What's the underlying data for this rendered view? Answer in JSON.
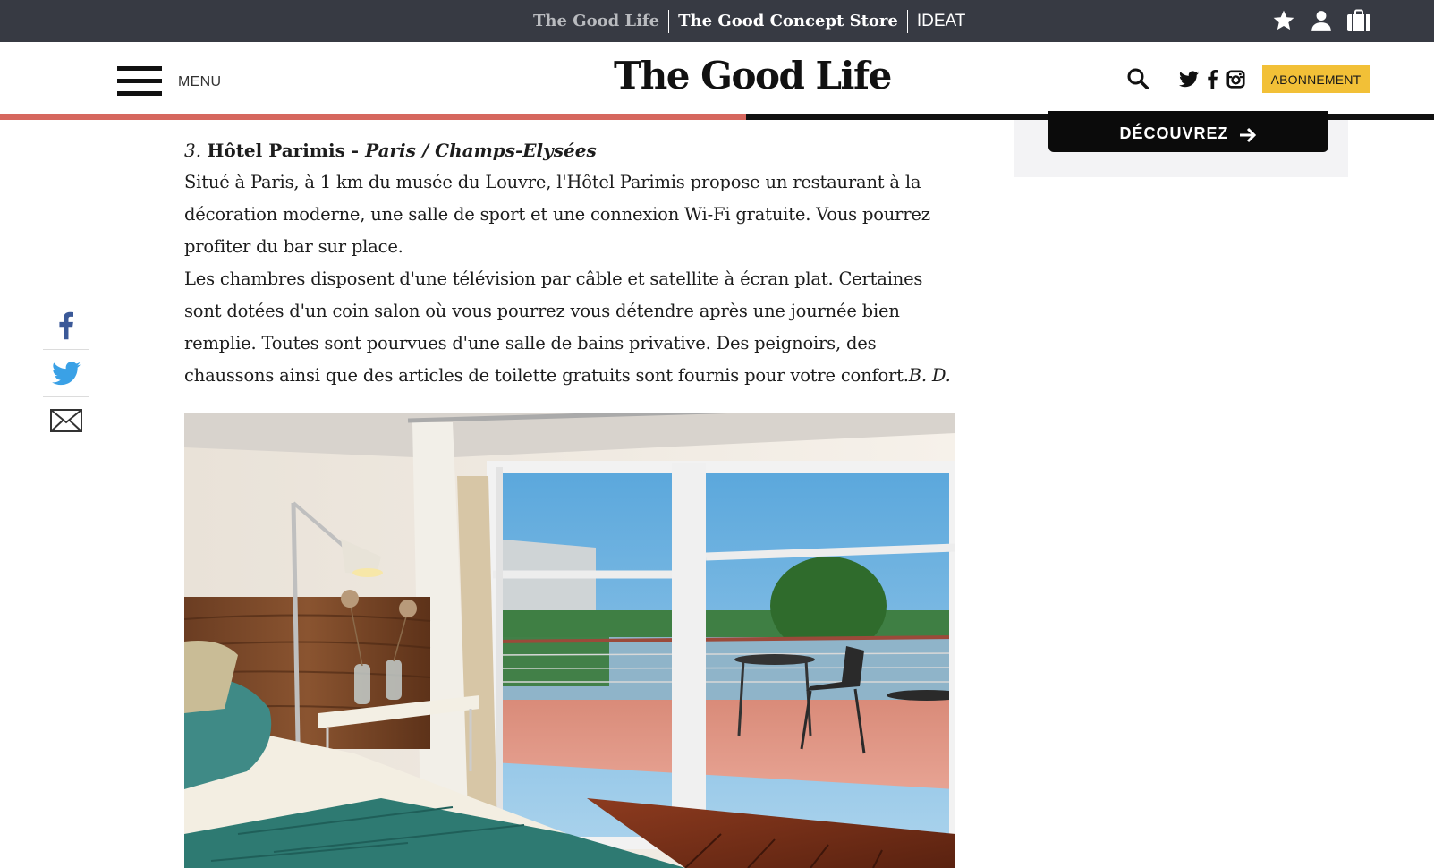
{
  "network_bar": {
    "sites": [
      {
        "label": "The Good Life"
      },
      {
        "label": "The Good Concept Store"
      },
      {
        "label": "IDEAT"
      }
    ],
    "icons": [
      "star-icon",
      "user-icon",
      "bag-icon"
    ]
  },
  "header": {
    "menu_label": "MENU",
    "logo": "The Good Life",
    "subscribe_label": "ABONNEMENT",
    "social": [
      "twitter-icon",
      "facebook-icon",
      "instagram-icon"
    ],
    "reading_progress": 0.52
  },
  "article": {
    "heading": {
      "number": "3.",
      "name": "Hôtel Parimis",
      "separator": " - ",
      "location": "Paris / Champs-Elysées"
    },
    "paragraph1": "Situé à Paris, à 1 km du musée du Louvre, l'Hôtel Parimis propose un restaurant à la décoration moderne, une salle de sport et une connexion Wi-Fi gratuite. Vous pourrez profiter du bar sur place.",
    "paragraph2": "Les chambres disposent d'une télévision par câble et satellite à écran plat. Certaines sont dotées d'un coin salon où vous pourrez vous détendre après une journée bien remplie. Toutes sont pourvues d'une salle de bains privative. Des peignoirs, des chaussons ainsi que des articles de toilette gratuits sont fournis pour votre confort.",
    "signature": "B. D."
  },
  "share": [
    "facebook-icon",
    "twitter-icon",
    "email-icon"
  ],
  "ad": {
    "button_label": "DÉCOUVREZ"
  },
  "colors": {
    "network_bar": "#373a43",
    "accent": "#d6675e",
    "subscribe": "#f2c037",
    "facebook": "#3b5998",
    "twitter": "#3aa1e6"
  }
}
